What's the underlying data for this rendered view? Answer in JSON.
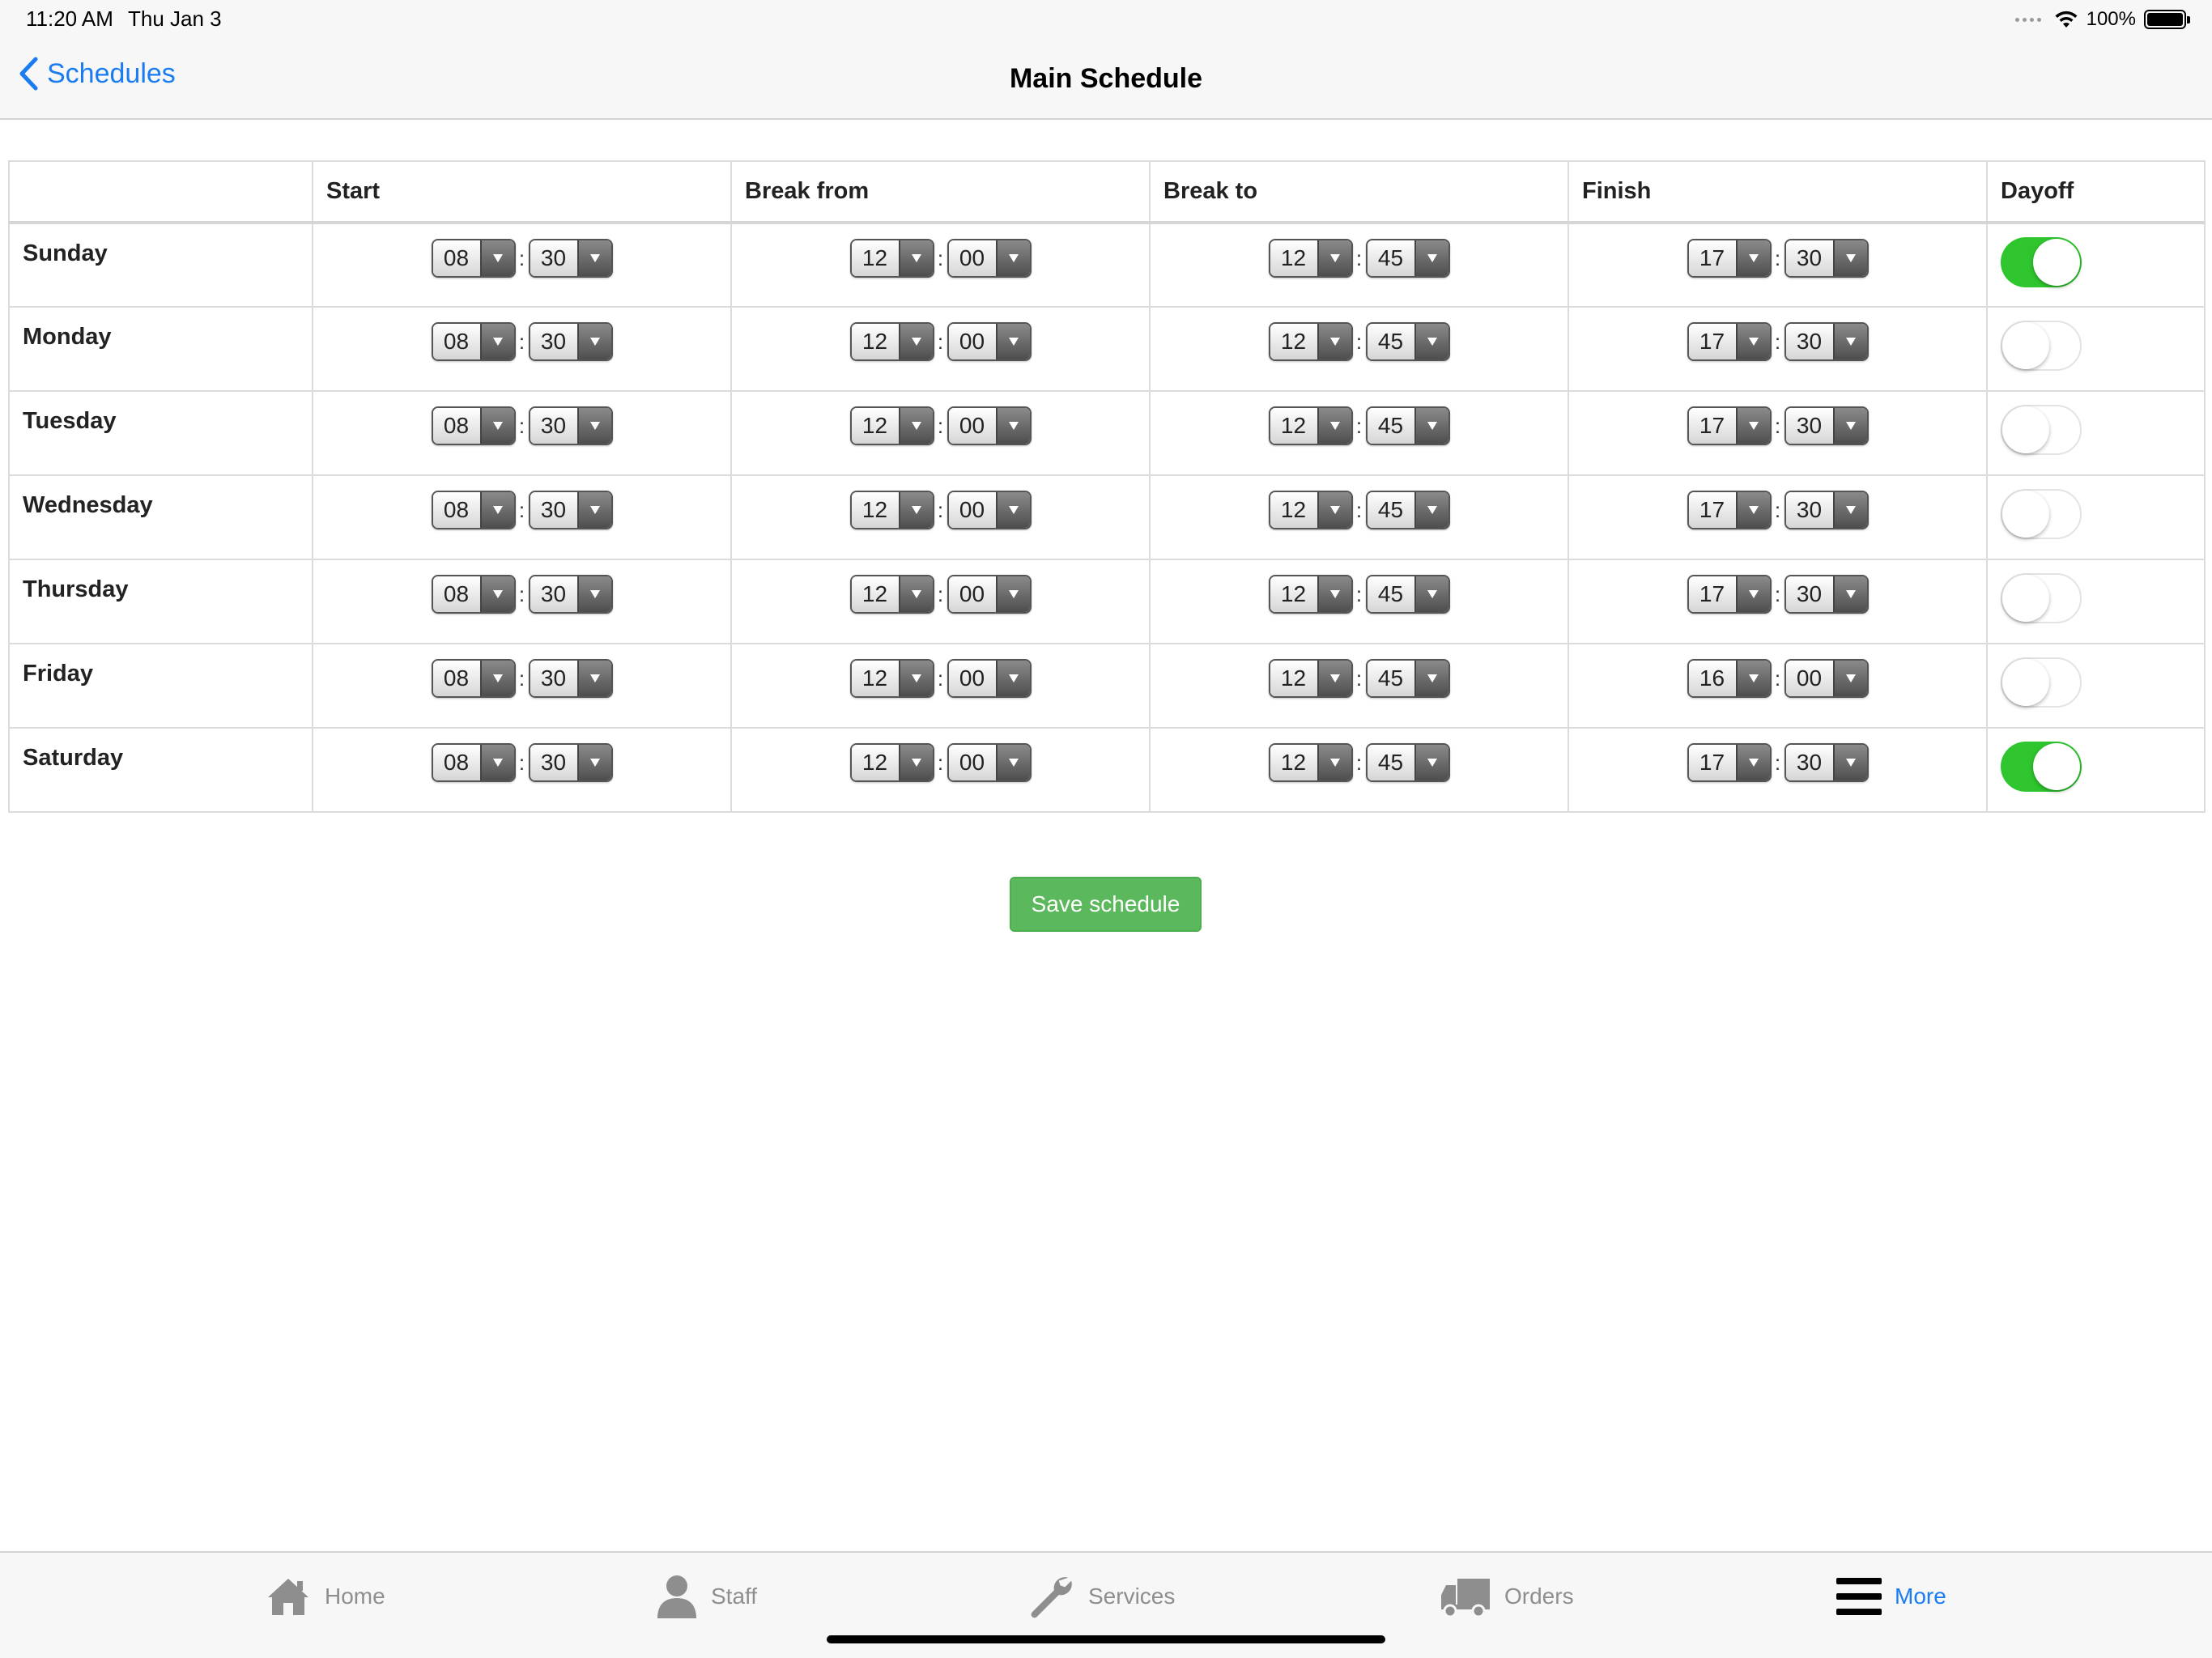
{
  "status_bar": {
    "time": "11:20 AM",
    "date": "Thu Jan 3",
    "battery": "100%"
  },
  "nav": {
    "back_label": "Schedules",
    "title": "Main Schedule"
  },
  "table": {
    "headers": [
      "",
      "Start",
      "Break from",
      "Break to",
      "Finish",
      "Dayoff"
    ],
    "rows": [
      {
        "day": "Sunday",
        "start": [
          "08",
          "30"
        ],
        "break_from": [
          "12",
          "00"
        ],
        "break_to": [
          "12",
          "45"
        ],
        "finish": [
          "17",
          "30"
        ],
        "dayoff": true
      },
      {
        "day": "Monday",
        "start": [
          "08",
          "30"
        ],
        "break_from": [
          "12",
          "00"
        ],
        "break_to": [
          "12",
          "45"
        ],
        "finish": [
          "17",
          "30"
        ],
        "dayoff": false
      },
      {
        "day": "Tuesday",
        "start": [
          "08",
          "30"
        ],
        "break_from": [
          "12",
          "00"
        ],
        "break_to": [
          "12",
          "45"
        ],
        "finish": [
          "17",
          "30"
        ],
        "dayoff": false
      },
      {
        "day": "Wednesday",
        "start": [
          "08",
          "30"
        ],
        "break_from": [
          "12",
          "00"
        ],
        "break_to": [
          "12",
          "45"
        ],
        "finish": [
          "17",
          "30"
        ],
        "dayoff": false
      },
      {
        "day": "Thursday",
        "start": [
          "08",
          "30"
        ],
        "break_from": [
          "12",
          "00"
        ],
        "break_to": [
          "12",
          "45"
        ],
        "finish": [
          "17",
          "30"
        ],
        "dayoff": false
      },
      {
        "day": "Friday",
        "start": [
          "08",
          "30"
        ],
        "break_from": [
          "12",
          "00"
        ],
        "break_to": [
          "12",
          "45"
        ],
        "finish": [
          "16",
          "00"
        ],
        "dayoff": false
      },
      {
        "day": "Saturday",
        "start": [
          "08",
          "30"
        ],
        "break_from": [
          "12",
          "00"
        ],
        "break_to": [
          "12",
          "45"
        ],
        "finish": [
          "17",
          "30"
        ],
        "dayoff": true
      }
    ],
    "time_separator": ":"
  },
  "save_button": "Save schedule",
  "tabs": [
    {
      "label": "Home",
      "icon": "home-icon",
      "active": false
    },
    {
      "label": "Staff",
      "icon": "person-icon",
      "active": false
    },
    {
      "label": "Services",
      "icon": "wrench-icon",
      "active": false
    },
    {
      "label": "Orders",
      "icon": "truck-icon",
      "active": false
    },
    {
      "label": "More",
      "icon": "menu-icon",
      "active": true
    }
  ],
  "colors": {
    "accent": "#1a7cf0",
    "toggle_on": "#2ec52e",
    "save_button": "#5cb85c",
    "tab_inactive": "#8e8e8e"
  }
}
